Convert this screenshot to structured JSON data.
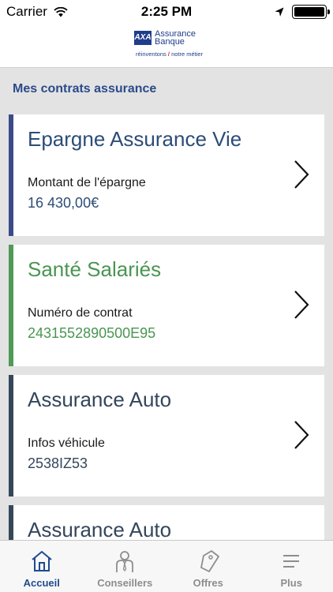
{
  "status_bar": {
    "carrier": "Carrier",
    "time": "2:25 PM",
    "wifi_icon": "wifi-icon",
    "location_icon": "location-arrow-icon",
    "battery_icon": "battery-icon"
  },
  "header": {
    "logo_mark": "AXA",
    "logo_line1": "Assurance",
    "logo_line2": "Banque",
    "tagline_part1": "réinventons",
    "tagline_part2": "notre métier"
  },
  "section": {
    "title": "Mes contrats assurance"
  },
  "cards": [
    {
      "title": "Epargne Assurance Vie",
      "label": "Montant de l'épargne",
      "value": "16 430,00€"
    },
    {
      "title": "Santé Salariés",
      "label": "Numéro de contrat",
      "value": "2431552890500E95"
    },
    {
      "title": "Assurance Auto",
      "label": "Infos véhicule",
      "value": "2538IZ53"
    },
    {
      "title": "Assurance Auto"
    }
  ],
  "tabs": [
    {
      "label": "Accueil",
      "icon": "home-icon",
      "active": true
    },
    {
      "label": "Conseillers",
      "icon": "advisor-icon",
      "active": false
    },
    {
      "label": "Offres",
      "icon": "tag-icon",
      "active": false
    },
    {
      "label": "Plus",
      "icon": "menu-icon",
      "active": false
    }
  ],
  "colors": {
    "accent": "#2b4a8a",
    "card_blue": "#3b4a8a",
    "card_green": "#4f9a55",
    "card_slate": "#37475a",
    "tab_active": "#1f4a8e",
    "tab_inactive": "#8d8d8d"
  }
}
